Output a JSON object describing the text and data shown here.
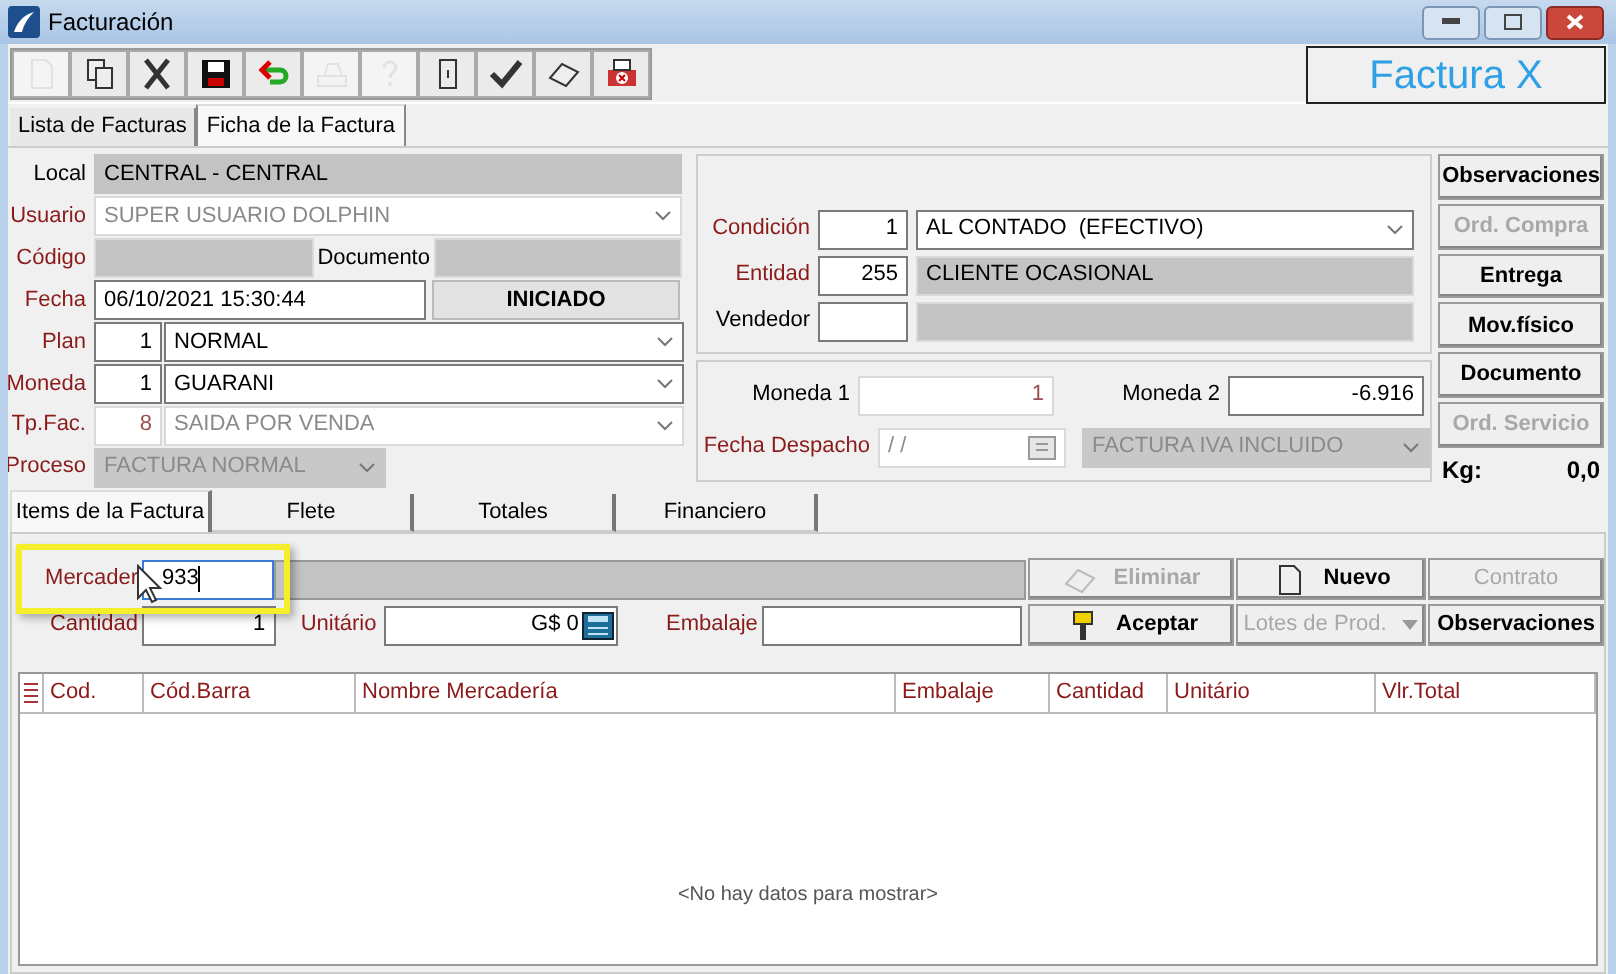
{
  "window": {
    "title": "Facturación"
  },
  "toolbar": [
    {
      "disabled": true
    },
    {
      "disabled": false
    },
    {
      "disabled": false
    },
    {
      "disabled": false
    },
    {
      "disabled": false
    },
    {
      "disabled": true
    },
    {
      "disabled": true
    },
    {
      "disabled": false
    },
    {
      "disabled": false
    },
    {
      "disabled": false
    },
    {
      "disabled": false
    }
  ],
  "logo": "Factura X",
  "tabs": [
    {
      "label": "Lista de Facturas",
      "selected": false
    },
    {
      "label": "Ficha de la Factura",
      "selected": true
    }
  ],
  "general": {
    "local": {
      "label": "Local",
      "required": false,
      "value": "CENTRAL - CENTRAL"
    },
    "usuario": {
      "label": "Usuario",
      "required": true,
      "value": "SUPER USUARIO DOLPHIN",
      "disabled": true
    },
    "codigo": {
      "label": "Código",
      "required": true
    },
    "documento": {
      "label": "Documento",
      "required": false
    },
    "fecha": {
      "label": "Fecha",
      "required": true,
      "value": "06/10/2021 15:30:44"
    },
    "status": "INICIADO",
    "plan": {
      "label": "Plan",
      "required": true,
      "code": "1",
      "value": "NORMAL",
      "disabled": false
    },
    "moneda": {
      "label": "Moneda",
      "required": true,
      "code": "1",
      "value": "GUARANI",
      "disabled": false
    },
    "tp_fac": {
      "label": "Tp.Fac.",
      "required": true,
      "code": "8",
      "value": "SAIDA POR VENDA",
      "disabled": true
    },
    "proceso": {
      "label": "Proceso",
      "required": true,
      "value": "FACTURA NORMAL",
      "disabled": true
    }
  },
  "customer": {
    "condicion": {
      "label": "Condición",
      "required": true,
      "code": "1",
      "value": "AL CONTADO  (EFECTIVO)"
    },
    "entidad": {
      "label": "Entidad",
      "required": true,
      "code": "255",
      "value": "CLIENTE OCASIONAL"
    },
    "vendedor": {
      "label": "Vendedor",
      "required": false
    }
  },
  "exchange": {
    "moneda_1": {
      "label": "Moneda 1",
      "value": "1"
    },
    "moneda_2": {
      "label": "Moneda 2",
      "value": "-6.916"
    },
    "fecha_despacho": {
      "label": "Fecha Despacho",
      "required": true,
      "value": "/ /",
      "disabled": true
    },
    "tipo": {
      "value": "FACTURA IVA INCLUIDO",
      "disabled": true
    }
  },
  "side_buttons": [
    {
      "label": "Observaciones",
      "disabled": false
    },
    {
      "label": "Ord. Compra",
      "disabled": true
    },
    {
      "label": "Entrega",
      "disabled": false
    },
    {
      "label": "Mov.físico",
      "disabled": false
    },
    {
      "label": "Documento",
      "disabled": false
    },
    {
      "label": "Ord. Servicio",
      "disabled": true
    }
  ],
  "weight": {
    "label": "Kg:",
    "value": "0,0"
  },
  "item_tabs": [
    {
      "label": "Items de la Factura",
      "selected": true
    },
    {
      "label": "Flete",
      "selected": false
    },
    {
      "label": "Totales",
      "selected": false
    },
    {
      "label": "Financiero",
      "selected": false
    }
  ],
  "item_entry": {
    "mercaderia": {
      "label": "Mercader",
      "required": true,
      "value": "933"
    },
    "cantidad": {
      "label": "Cantidad",
      "required": true,
      "value": "1"
    },
    "unitario": {
      "label": "Unitário",
      "required": true,
      "value": "G$ 0"
    },
    "embalaje": {
      "label": "Embalaje",
      "required": true
    }
  },
  "item_buttons": [
    {
      "label": "Eliminar",
      "disabled": true,
      "kind": "button"
    },
    {
      "label": "Nuevo",
      "disabled": false,
      "kind": "button"
    },
    {
      "label": "Contrato",
      "disabled": true,
      "kind": "button"
    },
    {
      "label": "Aceptar",
      "disabled": false,
      "kind": "button"
    },
    {
      "label": "Lotes de Prod.",
      "disabled": true,
      "kind": "dropdown"
    },
    {
      "label": "Observaciones",
      "disabled": false,
      "kind": "button"
    }
  ],
  "table": {
    "columns": [
      {
        "label": "Cod.",
        "required": true
      },
      {
        "label": "Cód.Barra",
        "required": true
      },
      {
        "label": "Nombre Mercadería",
        "required": true
      },
      {
        "label": "Embalaje",
        "required": true
      },
      {
        "label": "Cantidad",
        "required": true
      },
      {
        "label": "Unitário",
        "required": true
      },
      {
        "label": "Vlr.Total",
        "required": true
      }
    ],
    "empty_message": "<No hay datos para mostrar>"
  }
}
